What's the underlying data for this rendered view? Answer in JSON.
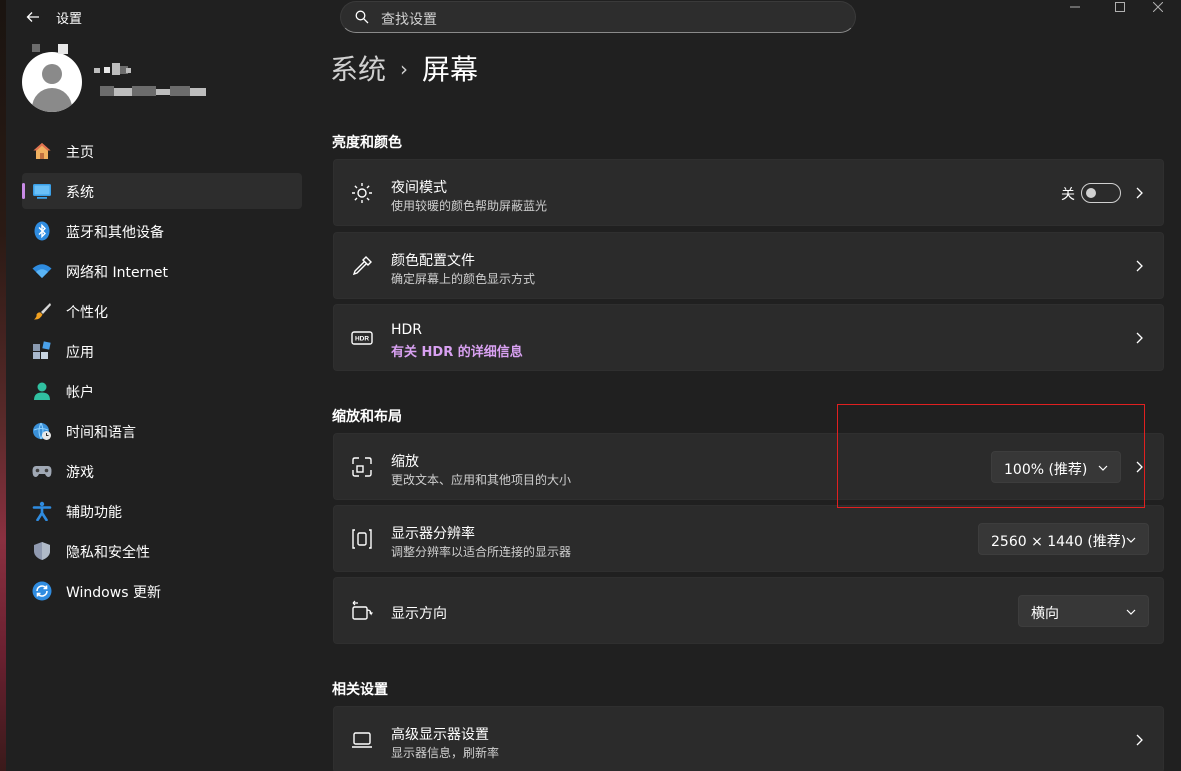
{
  "app": {
    "title": "设置"
  },
  "search": {
    "placeholder": "查找设置"
  },
  "nav": {
    "items": [
      {
        "label": "主页",
        "icon": "home-icon"
      },
      {
        "label": "系统",
        "icon": "system-icon",
        "active": true
      },
      {
        "label": "蓝牙和其他设备",
        "icon": "bluetooth-icon"
      },
      {
        "label": "网络和 Internet",
        "icon": "wifi-icon"
      },
      {
        "label": "个性化",
        "icon": "brush-icon"
      },
      {
        "label": "应用",
        "icon": "apps-icon"
      },
      {
        "label": "帐户",
        "icon": "account-icon"
      },
      {
        "label": "时间和语言",
        "icon": "globe-clock-icon"
      },
      {
        "label": "游戏",
        "icon": "gamepad-icon"
      },
      {
        "label": "辅助功能",
        "icon": "accessibility-icon"
      },
      {
        "label": "隐私和安全性",
        "icon": "shield-icon"
      },
      {
        "label": "Windows 更新",
        "icon": "update-icon"
      }
    ]
  },
  "breadcrumb": {
    "parent": "系统",
    "separator": "›",
    "current": "屏幕"
  },
  "sections": {
    "brightness": {
      "title": "亮度和颜色"
    },
    "scale_layout": {
      "title": "缩放和布局"
    },
    "related": {
      "title": "相关设置"
    }
  },
  "cards": {
    "night_light": {
      "title": "夜间模式",
      "subtitle": "使用较暖的颜色帮助屏蔽蓝光",
      "toggle_label": "关",
      "toggle_on": false
    },
    "color_profile": {
      "title": "颜色配置文件",
      "subtitle": "确定屏幕上的颜色显示方式"
    },
    "hdr": {
      "title": "HDR",
      "link": "有关 HDR 的详细信息"
    },
    "scale": {
      "title": "缩放",
      "subtitle": "更改文本、应用和其他项目的大小",
      "value": "100% (推荐)"
    },
    "resolution": {
      "title": "显示器分辨率",
      "subtitle": "调整分辨率以适合所连接的显示器",
      "value": "2560 × 1440 (推荐)"
    },
    "orientation": {
      "title": "显示方向",
      "value": "横向"
    },
    "advanced_display": {
      "title": "高级显示器设置",
      "subtitle": "显示器信息，刷新率"
    }
  },
  "colors": {
    "accent": "#c98be6",
    "link": "#d9a1f2",
    "highlight_box": "#e02020",
    "card_bg": "#2b2b2b",
    "window_bg": "#202020"
  }
}
